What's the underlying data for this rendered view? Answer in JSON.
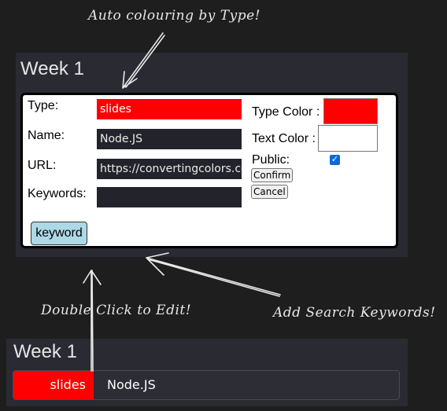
{
  "annotations": {
    "auto_colouring": "Auto colouring by Type!",
    "double_click": "Double Click to Edit!",
    "add_keywords": "Add Search Keywords!"
  },
  "editor": {
    "week_title": "Week 1",
    "labels": {
      "type": "Type:",
      "name": "Name:",
      "url": "URL:",
      "keywords": "Keywords:",
      "type_color": "Type Color :",
      "text_color": "Text Color :",
      "public": "Public:"
    },
    "values": {
      "type": "slides",
      "name": "Node.JS",
      "url": "https://convertingcolors.com",
      "keywords": ""
    },
    "type_color": "#ff0000",
    "text_color": "#ffffff",
    "public_checked": true,
    "buttons": {
      "confirm": "Confirm",
      "cancel": "Cancel",
      "keyword": "keyword"
    }
  },
  "preview": {
    "week_title": "Week 1",
    "row": {
      "type": "slides",
      "name": "Node.JS"
    }
  }
}
